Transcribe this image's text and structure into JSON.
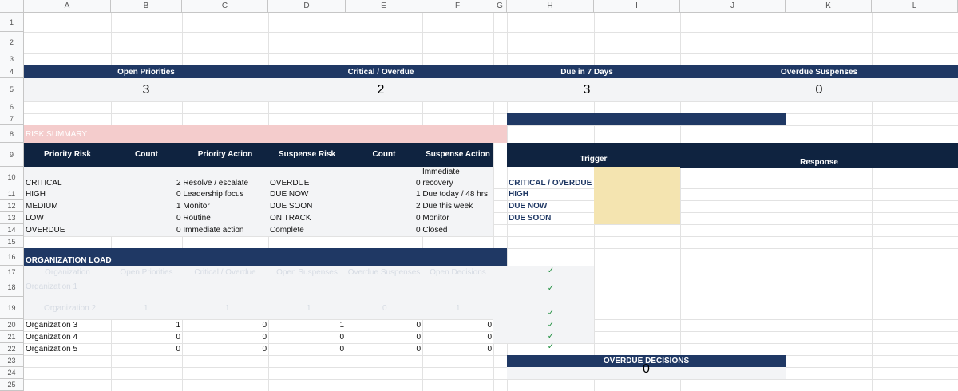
{
  "columns": [
    "A",
    "B",
    "C",
    "D",
    "E",
    "F",
    "G",
    "H",
    "I",
    "J",
    "K",
    "L"
  ],
  "rows": [
    "1",
    "2",
    "3",
    "4",
    "5",
    "6",
    "7",
    "8",
    "9",
    "10",
    "11",
    "12",
    "13",
    "14",
    "15",
    "16",
    "17",
    "18",
    "19",
    "20",
    "21",
    "22",
    "23",
    "24",
    "25"
  ],
  "kpis": [
    {
      "title": "Open Priorities",
      "value": "3"
    },
    {
      "title": "Critical / Overdue",
      "value": "2"
    },
    {
      "title": "Due in 7 Days",
      "value": "3"
    },
    {
      "title": "Overdue Suspenses",
      "value": "0"
    }
  ],
  "risk_summary": {
    "section_title": "RISK SUMMARY",
    "headers": [
      "Priority Risk",
      "Count",
      "Priority Action",
      "Suspense Risk",
      "Count",
      "Suspense Action"
    ],
    "rows": [
      {
        "priority": "CRITICAL",
        "priority_action": "2 Resolve / escalate",
        "suspense": "OVERDUE",
        "suspense_action_line1": "Immediate",
        "suspense_action": "0 recovery"
      },
      {
        "priority": "HIGH",
        "priority_action": "0 Leadership focus",
        "suspense": "DUE NOW",
        "suspense_action": "1 Due today / 48 hrs"
      },
      {
        "priority": "MEDIUM",
        "priority_action": "1 Monitor",
        "suspense": "DUE SOON",
        "suspense_action": "2 Due this week"
      },
      {
        "priority": "LOW",
        "priority_action": "0 Routine",
        "suspense": "ON TRACK",
        "suspense_action": "0 Monitor"
      },
      {
        "priority": "OVERDUE",
        "priority_action": "0 Immediate action",
        "suspense": "Complete",
        "suspense_action": "0 Closed"
      }
    ]
  },
  "trigger_table": {
    "headers": [
      "Trigger",
      "Response"
    ],
    "triggers": [
      "CRITICAL / OVERDUE",
      "HIGH",
      "DUE NOW",
      "DUE SOON"
    ],
    "highlight_color": "#f4e4b0"
  },
  "org_load": {
    "section_title": "ORGANIZATION LOAD",
    "headers": [
      "Organization",
      "Open Priorities",
      "Critical / Overdue",
      "Open Suspenses",
      "Overdue Suspenses",
      "Open Decisions"
    ],
    "faint_rows": [
      {
        "name": "Organization 1"
      },
      {
        "name": "Organization 2",
        "values": [
          "1",
          "1",
          "1",
          "0",
          "1"
        ]
      }
    ],
    "rows": [
      {
        "name": "Organization 3",
        "values": [
          "1",
          "0",
          "1",
          "0",
          "0"
        ]
      },
      {
        "name": "Organization 4",
        "values": [
          "0",
          "0",
          "0",
          "0",
          "0"
        ]
      },
      {
        "name": "Organization 5",
        "values": [
          "0",
          "0",
          "0",
          "0",
          "0"
        ]
      }
    ],
    "checks": [
      "✓",
      "✓",
      "✓",
      "✓",
      "✓",
      "✓"
    ]
  },
  "overdue_decisions": {
    "title": "OVERDUE DECISIONS",
    "value": "0"
  },
  "colors": {
    "navy": "#1f3864",
    "navy_dark": "#0f2340",
    "risk_pink": "#f4cccc",
    "band_gray": "#f3f4f6",
    "highlight": "#f4e4b0",
    "check_green": "#1e8e3e"
  }
}
